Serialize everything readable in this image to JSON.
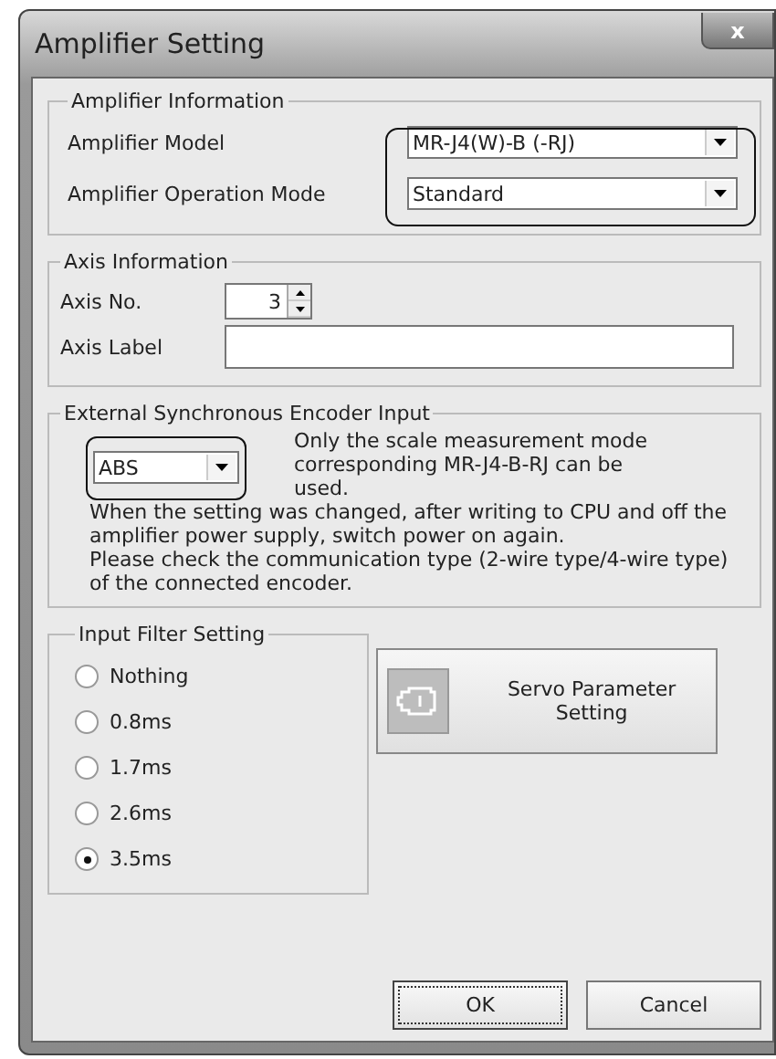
{
  "window": {
    "title": "Amplifier Setting",
    "close": "x"
  },
  "amplifier_information": {
    "legend": "Amplifier Information",
    "fields": [
      {
        "label": "Amplifier Model",
        "value": "MR-J4(W)-B (-RJ)"
      },
      {
        "label": "Amplifier Operation Mode",
        "value": "Standard"
      }
    ]
  },
  "axis_information": {
    "legend": "Axis Information",
    "axis_no": {
      "label": "Axis No.",
      "value": "3"
    },
    "axis_label": {
      "label": "Axis Label"
    }
  },
  "external_encoder": {
    "legend": "External Synchronous Encoder Input",
    "value": "ABS",
    "note": "Only the scale measurement mode corresponding MR-J4-B-RJ can be used.",
    "description": [
      "When the setting was changed, after writing to CPU and off the amplifier power supply, switch power on again.",
      "Please check the communication type (2-wire type/4-wire type) of the connected encoder."
    ]
  },
  "input_filter": {
    "legend": "Input Filter Setting",
    "options": [
      {
        "label": "Nothing",
        "selected": false
      },
      {
        "label": "0.8ms",
        "selected": false
      },
      {
        "label": "1.7ms",
        "selected": false
      },
      {
        "label": "2.6ms",
        "selected": false
      },
      {
        "label": "3.5ms",
        "selected": true
      }
    ]
  },
  "servo_button": "Servo Parameter Setting",
  "buttons": [
    {
      "label": "OK",
      "focused": true
    },
    {
      "label": "Cancel",
      "focused": false
    }
  ]
}
